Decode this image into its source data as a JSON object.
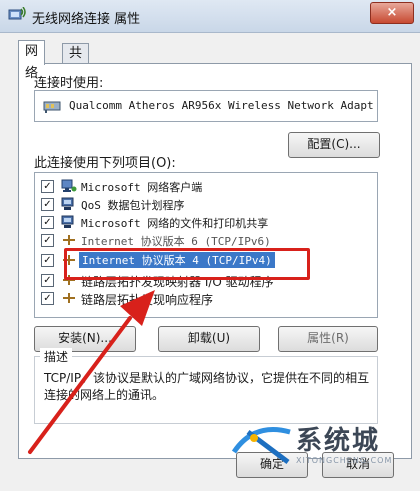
{
  "window": {
    "title": "无线网络连接 属性",
    "close_label": "×"
  },
  "tabs": [
    {
      "label": "网络"
    },
    {
      "label": "共享"
    }
  ],
  "connect_using_label": "连接时使用:",
  "adapter_name": "Qualcomm Atheros AR956x Wireless Network Adapt",
  "configure_button": "配置(C)...",
  "items_label": "此连接使用下列项目(O):",
  "items": [
    {
      "text": "Microsoft 网络客户端",
      "checked": true,
      "icon": "network-client-icon"
    },
    {
      "text": "QoS 数据包计划程序",
      "checked": true,
      "icon": "qos-scheduler-icon"
    },
    {
      "text": "Microsoft 网络的文件和打印机共享",
      "checked": true,
      "icon": "file-printer-sharing-icon"
    },
    {
      "text": "Internet 协议版本 6 (TCP/IPv6)",
      "checked": true,
      "icon": "protocol-icon"
    },
    {
      "text": "Internet 协议版本 4 (TCP/IPv4)",
      "checked": true,
      "icon": "protocol-icon"
    },
    {
      "text": "链路层拓扑发现映射器 I/O 驱动程序",
      "checked": true,
      "icon": "protocol-icon"
    },
    {
      "text": "链路层拓扑发现响应程序",
      "checked": true,
      "icon": "protocol-icon"
    }
  ],
  "check_mark": "✓",
  "buttons": {
    "install": "安装(N)...",
    "uninstall": "卸载(U)",
    "properties": "属性(R)"
  },
  "description": {
    "title": "描述",
    "text": "TCP/IP。该协议是默认的广域网络协议，它提供在不同的相互连接的网络上的通讯。"
  },
  "footer_buttons": {
    "ok": "确定",
    "cancel": "取消"
  },
  "watermark": {
    "text": "系统城",
    "sub": "XITONGCHENG.COM"
  },
  "colors": {
    "selection": "#3b78c8",
    "annotation_red": "#d8211b"
  }
}
